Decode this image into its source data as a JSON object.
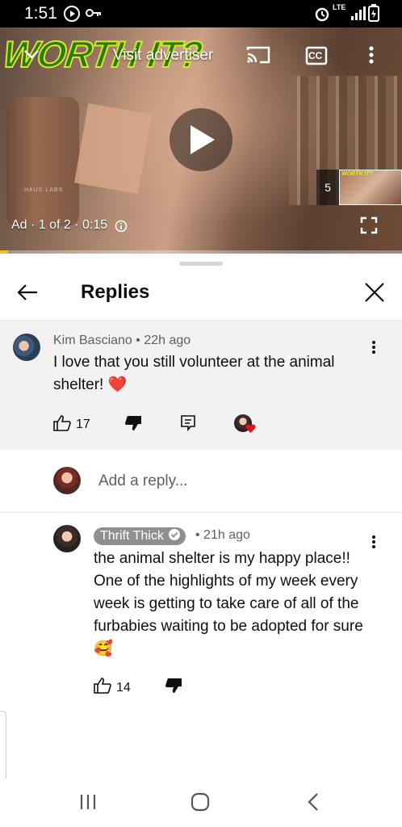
{
  "status_bar": {
    "time": "1:51",
    "network": "LTE",
    "icons": [
      "play-notification-icon",
      "key-icon",
      "alarm-icon",
      "signal-icon",
      "battery-icon"
    ]
  },
  "video": {
    "overlay_text": "WORTH IT?",
    "visit_advertiser": "Visit advertiser",
    "cc_label": "CC",
    "ad_info": "Ad · 1 of 2 · 0:15",
    "skip_countdown": "5",
    "thumbnail_text": "WORTH IT?",
    "bottle_text": "HAUS LABS",
    "progress_fraction": 0.02,
    "progress_color": "#f2c21b"
  },
  "sheet": {
    "title": "Replies",
    "parent_comment": {
      "author": "Kim Basciano",
      "time": "22h ago",
      "text": "I love that you still volunteer at the animal shelter! ❤️",
      "likes": "17"
    },
    "add_reply_placeholder": "Add a reply...",
    "reply": {
      "author": "Thrift Thick",
      "time": "21h ago",
      "text": "the animal shelter is my happy place!! One of the highlights of my week every week is getting to take care of all of the furbabies waiting to be adopted for sure 🥰",
      "likes": "14"
    }
  },
  "colors": {
    "accent_heart": "#e5141a",
    "parent_bg": "#f2f2f2",
    "creator_chip_bg": "#8f8f8f"
  }
}
